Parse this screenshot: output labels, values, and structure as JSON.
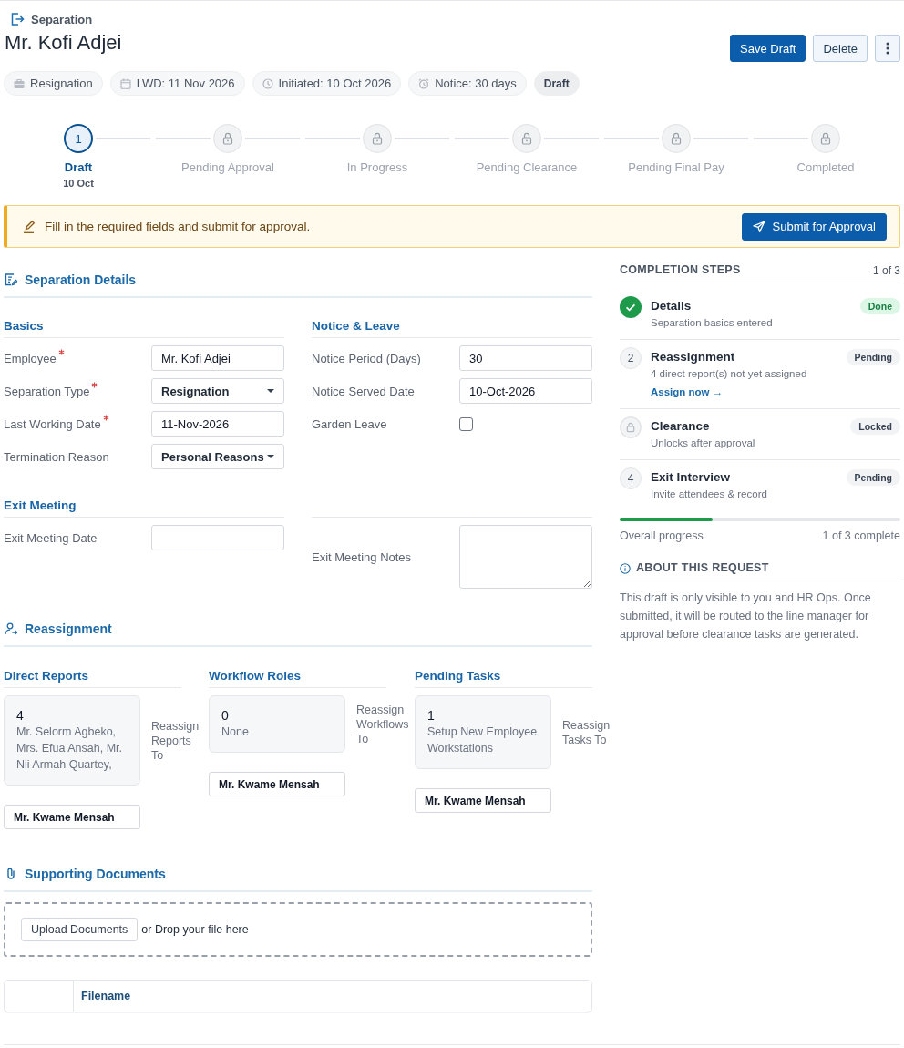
{
  "header": {
    "breadcrumb": "Separation",
    "title": "Mr. Kofi Adjei",
    "actions": [
      {
        "kind": "primary",
        "label": "Save Draft"
      },
      {
        "kind": "secondary",
        "label": "Delete"
      },
      {
        "kind": "more"
      }
    ]
  },
  "chips": [
    {
      "kind": "type",
      "label": "Resignation"
    },
    {
      "kind": "date",
      "label": "LWD: 11 Nov 2026"
    },
    {
      "kind": "clock",
      "label": "Initiated: 10 Oct 2026"
    },
    {
      "kind": "alarm",
      "label": "Notice: 30 days"
    },
    {
      "kind": "status",
      "label": "Draft"
    }
  ],
  "stepper": [
    {
      "label": "Draft",
      "number": "1",
      "date": "10 Oct",
      "selected": true,
      "locked": false
    },
    {
      "label": "Pending Approval",
      "selected": false,
      "locked": true
    },
    {
      "label": "In Progress",
      "selected": false,
      "locked": true
    },
    {
      "label": "Pending Clearance",
      "selected": false,
      "locked": true
    },
    {
      "label": "Pending Final Pay",
      "selected": false,
      "locked": true
    },
    {
      "label": "Completed",
      "selected": false,
      "locked": true
    }
  ],
  "banner": {
    "text": "Fill in the required fields and submit for approval.",
    "button": "Submit for Approval"
  },
  "details": {
    "title": "Separation Details",
    "groups": [
      {
        "title": "Basics",
        "fields": [
          {
            "label": "Employee",
            "required": true,
            "kind": "text",
            "value": "Mr. Kofi Adjei"
          },
          {
            "label": "Separation Type",
            "required": true,
            "kind": "select",
            "value": "Resignation"
          },
          {
            "label": "Last Working Date",
            "required": true,
            "kind": "text",
            "value": "11-Nov-2026"
          },
          {
            "label": "Termination Reason",
            "required": false,
            "kind": "select",
            "value": "Personal Reasons"
          }
        ]
      },
      {
        "title": "Notice & Leave",
        "fields": [
          {
            "label": "Notice Period (Days)",
            "required": false,
            "kind": "text",
            "value": "30"
          },
          {
            "label": "Notice Served Date",
            "required": false,
            "kind": "text",
            "value": "10-Oct-2026"
          },
          {
            "label": "Garden Leave",
            "required": false,
            "kind": "checkbox",
            "checked": false
          }
        ]
      },
      {
        "title": "Exit Meeting",
        "fields": [
          {
            "label": "Exit Meeting Date",
            "required": false,
            "kind": "text"
          }
        ]
      },
      {
        "fields": [
          {
            "label": "Exit Meeting Notes",
            "required": false,
            "kind": "textarea"
          }
        ]
      }
    ]
  },
  "reassignment": {
    "title": "Reassignment",
    "columns": [
      {
        "title": "Direct Reports",
        "count": "4",
        "summary": "Mr. Selorm Agbeko, Mrs. Efua Ansah, Mr. Nii Armah Quartey,",
        "target_label": "Reassign Reports To",
        "assignee": "Mr. Kwame Mensah"
      },
      {
        "title": "Workflow Roles",
        "count": "0",
        "summary": "None",
        "target_label": "Reassign Workflows To",
        "assignee": "Mr. Kwame Mensah"
      },
      {
        "title": "Pending Tasks",
        "count": "1",
        "summary": "Setup New Employee Workstations",
        "target_label": "Reassign Tasks To",
        "assignee": "Mr. Kwame Mensah"
      }
    ]
  },
  "documents": {
    "title": "Supporting Documents",
    "upload_button": "Upload Documents",
    "drop_hint": "or Drop your file here",
    "table": {
      "columns": [
        "Filename"
      ]
    }
  },
  "completion": {
    "title": "COMPLETION STEPS",
    "count": "1 of 3",
    "steps": [
      {
        "kind": "done",
        "title": "Details",
        "subtitle": "Separation basics entered",
        "status": "Done"
      },
      {
        "kind": "pending",
        "marker": "2",
        "title": "Reassignment",
        "subtitle": "4 direct report(s) not yet assigned",
        "link": "Assign now →",
        "status": "Pending"
      },
      {
        "kind": "locked",
        "title": "Clearance",
        "subtitle": "Unlocks after approval",
        "status": "Locked"
      },
      {
        "kind": "pending",
        "marker": "4",
        "title": "Exit Interview",
        "subtitle": "Invite attendees & record",
        "status": "Pending"
      }
    ],
    "progress": {
      "label": "Overall progress",
      "level": 0.33,
      "reading": "1 of 3 complete"
    }
  },
  "about": {
    "title": "ABOUT THIS REQUEST",
    "text": "This draft is only visible to you and HR Ops. Once submitted, it will be routed to the line manager for approval before clearance tasks are generated."
  }
}
